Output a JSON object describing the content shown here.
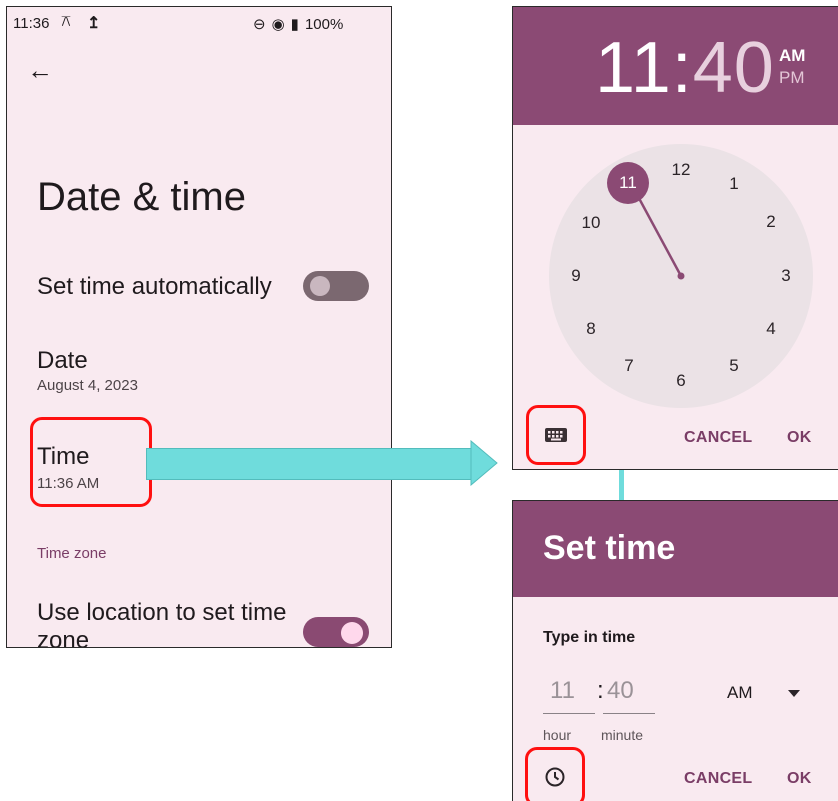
{
  "status_bar": {
    "time": "11:36",
    "battery": "100%"
  },
  "settings": {
    "title": "Date & time",
    "auto_time_label": "Set time automatically",
    "auto_time_on": false,
    "date_label": "Date",
    "date_value": "August 4, 2023",
    "time_label": "Time",
    "time_value": "11:36 AM",
    "section_time_zone": "Time zone",
    "location_label_line1": "Use location to set time",
    "location_label_line2": "zone",
    "location_on": true
  },
  "clock_dialog": {
    "hour": "11",
    "separator": ":",
    "minute": "40",
    "am": "AM",
    "pm": "PM",
    "selected_hour": "11",
    "dial_numbers": [
      "12",
      "1",
      "2",
      "3",
      "4",
      "5",
      "6",
      "7",
      "8",
      "9",
      "10"
    ],
    "cancel": "CANCEL",
    "ok": "OK"
  },
  "set_time_dialog": {
    "title": "Set time",
    "subtitle": "Type in time",
    "hour_value": "11",
    "separator": ":",
    "minute_value": "40",
    "period": "AM",
    "hour_label": "hour",
    "minute_label": "minute",
    "cancel": "CANCEL",
    "ok": "OK"
  },
  "colors": {
    "accent": "#8b4a74",
    "background": "#f9eaf0",
    "highlight": "#ff1010",
    "connector": "#6fdcdc"
  }
}
